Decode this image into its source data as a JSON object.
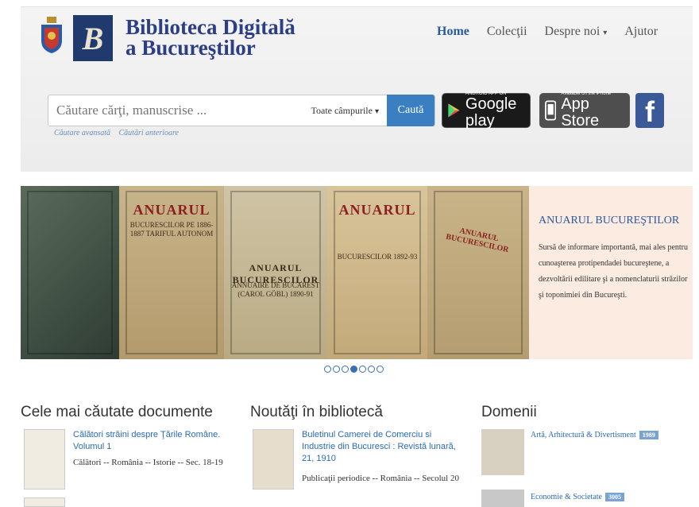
{
  "header": {
    "title_line1": "Biblioteca Digitală",
    "title_line2": "a Bucureştilor",
    "nav": [
      {
        "label": "Home",
        "active": true
      },
      {
        "label": "Colecţii",
        "active": false
      },
      {
        "label": "Despre noi",
        "active": false,
        "dropdown": true
      },
      {
        "label": "Ajutor",
        "active": false
      }
    ]
  },
  "search": {
    "placeholder": "Căutare cărţi, manuscrise ...",
    "scope": "Toate câmpurile",
    "button": "Caută",
    "link_advanced": "Căutare avansată",
    "link_history": "Căutări anterioare"
  },
  "stores": {
    "google_small": "ANDROID APP ON",
    "google_big": "Google play",
    "apple_small": "Available on the iPhone",
    "apple_big": "App Store",
    "facebook": "f"
  },
  "carousel": {
    "books": [
      {
        "title": "",
        "sub": ""
      },
      {
        "title": "ANUARUL",
        "sub": "BUCURESCILOR PE 1886-1887 TARIFUL AUTONOM"
      },
      {
        "title": "ANUARUL BUCURESCILOR",
        "sub": "ANNUAIRE DE BUCAREST (CAROL GÖBL) 1890-91"
      },
      {
        "title": "ANUARUL",
        "sub": "BUCURESCILOR 1892-93"
      },
      {
        "title": "",
        "sub": "ANUARUL BUCURESCILOR"
      }
    ],
    "slide_title": "ANUARUL BUCUREŞTILOR",
    "slide_description": "Sursă de informare importantă, mai ales pentru cunoaşterea protipendadei bucureştene, a dezvoltării edilitare şi a nomenclaturii străzilor şi toponimiei din Bucureşti.",
    "dot_count": 7,
    "active_dot": 3
  },
  "columns": {
    "most_searched": {
      "title": "Cele mai căutate documente",
      "item_title": "Călători străini despre Ţările Române. Volumul 1",
      "item_subject": "Călători -- România -- Istorie -- Sec. 18-19"
    },
    "news": {
      "title": "Noutăţi în bibliotecă",
      "item_title": "Buletinul Camerei de Comerciu si Industrie din Bucuresci : Revistă lunară, 21, 1910",
      "item_subject": "Publicaţii periodice -- România -- Secolul 20"
    },
    "domains": {
      "title": "Domenii",
      "items": [
        {
          "label": "Artă, Arhitectură & Divertisment",
          "count": "1989"
        },
        {
          "label": "Economie & Societate",
          "count": "3005"
        }
      ]
    }
  }
}
